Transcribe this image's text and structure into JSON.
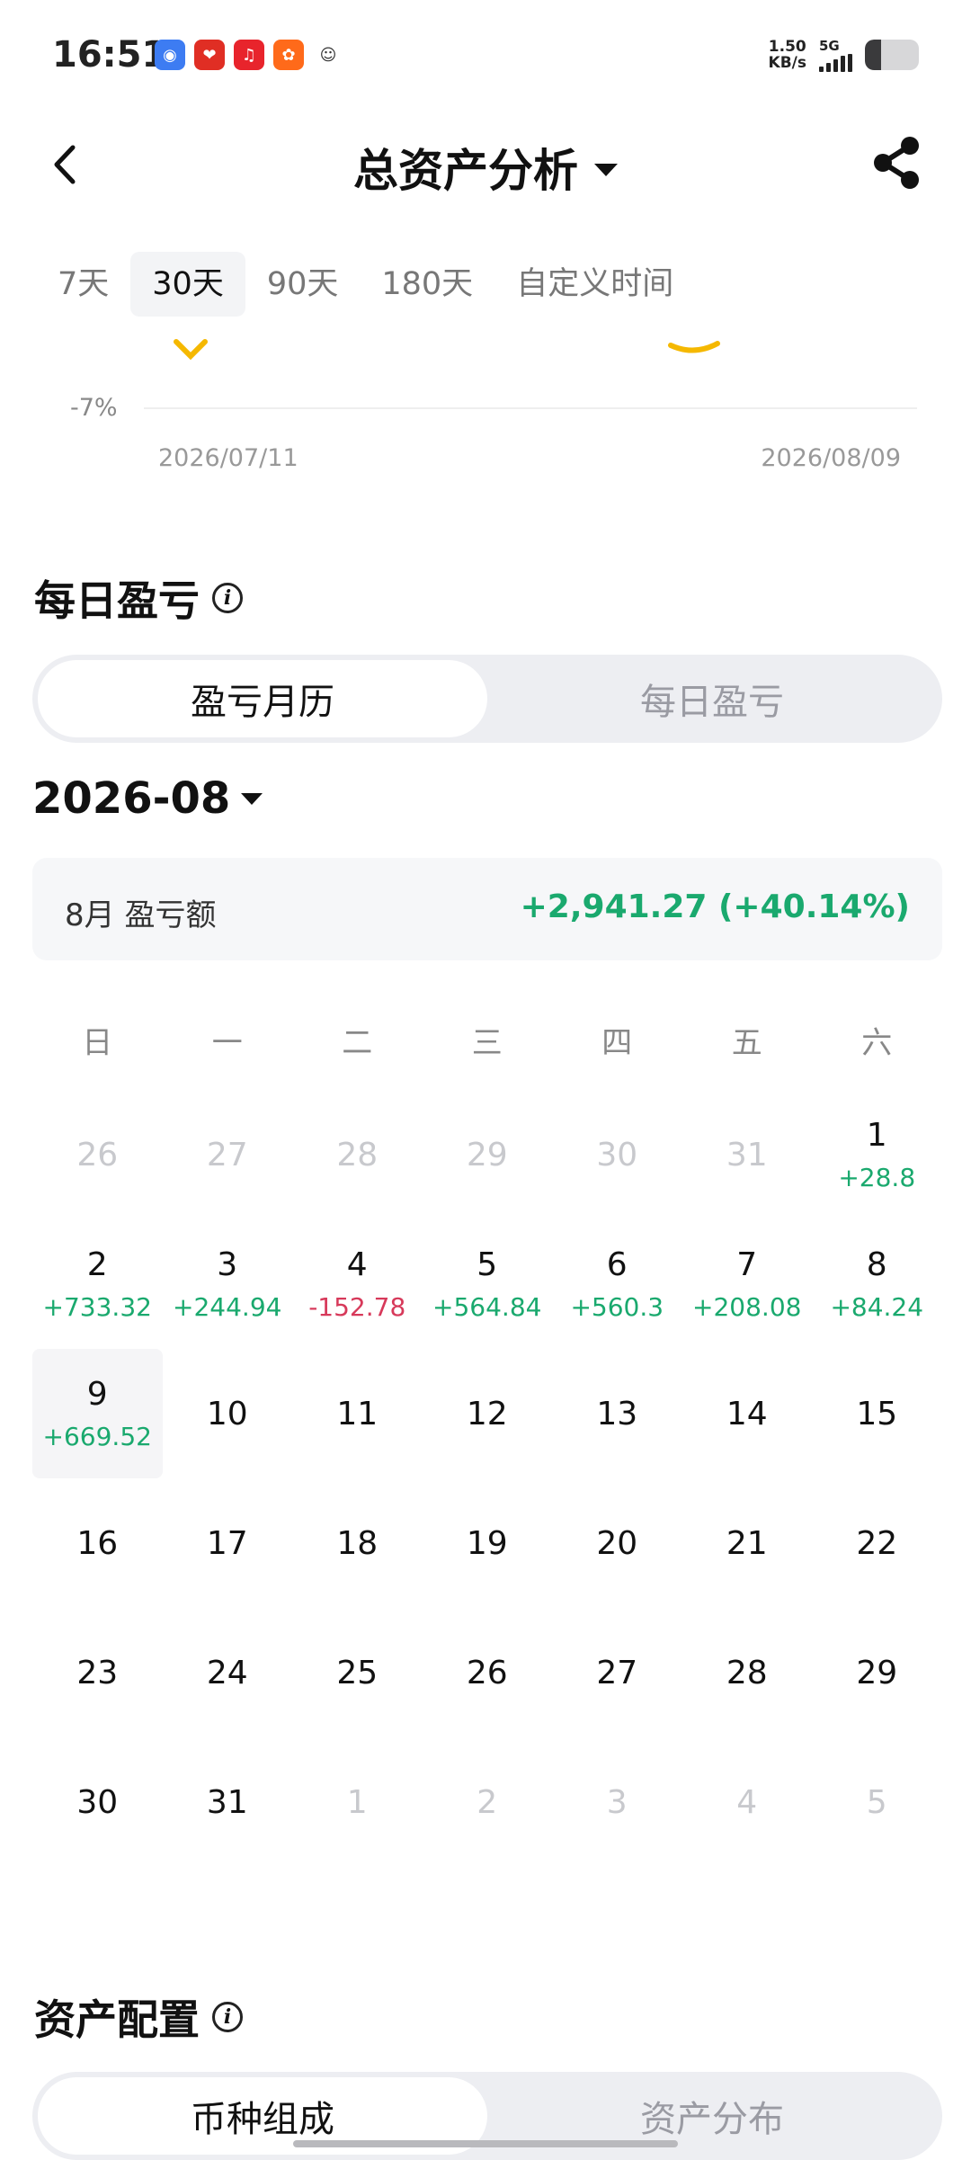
{
  "status": {
    "time": "16:51",
    "net_speed_value": "1.50",
    "net_speed_unit": "KB/s",
    "signal": "5G",
    "battery_level": 0.3,
    "apps": [
      {
        "icon": "baidu-icon",
        "color": "#3d7cf2",
        "glyph": "◉"
      },
      {
        "icon": "pinduoduo-icon",
        "color": "#e02e24",
        "glyph": "❤"
      },
      {
        "icon": "music-icon",
        "color": "#e8242c",
        "glyph": "♫"
      },
      {
        "icon": "kuaishou-icon",
        "color": "#ff6a1a",
        "glyph": "✿"
      },
      {
        "icon": "avatar-icon",
        "color": "#ffffff",
        "glyph": "☺"
      }
    ]
  },
  "header": {
    "title": "总资产分析"
  },
  "tabs": [
    "7天",
    "30天",
    "90天",
    "180天",
    "自定义时间"
  ],
  "active_tab": 1,
  "chart": {
    "y_label": "-7%",
    "x_start": "2026/07/11",
    "x_end": "2026/08/09"
  },
  "daily_pnl": {
    "title": "每日盈亏",
    "seg_active": "盈亏月历",
    "seg_inactive": "每日盈亏",
    "month": "2026-08",
    "summary_label": "8月 盈亏额",
    "summary_value": "+2,941.27 (+40.14%)",
    "weekdays": [
      "日",
      "一",
      "二",
      "三",
      "四",
      "五",
      "六"
    ],
    "days": [
      {
        "d": "26",
        "p": "",
        "t": "out"
      },
      {
        "d": "27",
        "p": "",
        "t": "out"
      },
      {
        "d": "28",
        "p": "",
        "t": "out"
      },
      {
        "d": "29",
        "p": "",
        "t": "out"
      },
      {
        "d": "30",
        "p": "",
        "t": "out"
      },
      {
        "d": "31",
        "p": "",
        "t": "out"
      },
      {
        "d": "1",
        "p": "+28.8",
        "t": "pos"
      },
      {
        "d": "2",
        "p": "+733.32",
        "t": "pos"
      },
      {
        "d": "3",
        "p": "+244.94",
        "t": "pos"
      },
      {
        "d": "4",
        "p": "-152.78",
        "t": "neg"
      },
      {
        "d": "5",
        "p": "+564.84",
        "t": "pos"
      },
      {
        "d": "6",
        "p": "+560.3",
        "t": "pos"
      },
      {
        "d": "7",
        "p": "+208.08",
        "t": "pos"
      },
      {
        "d": "8",
        "p": "+84.24",
        "t": "pos"
      },
      {
        "d": "9",
        "p": "+669.52",
        "t": "pos today"
      },
      {
        "d": "10",
        "p": "",
        "t": ""
      },
      {
        "d": "11",
        "p": "",
        "t": ""
      },
      {
        "d": "12",
        "p": "",
        "t": ""
      },
      {
        "d": "13",
        "p": "",
        "t": ""
      },
      {
        "d": "14",
        "p": "",
        "t": ""
      },
      {
        "d": "15",
        "p": "",
        "t": ""
      },
      {
        "d": "16",
        "p": "",
        "t": ""
      },
      {
        "d": "17",
        "p": "",
        "t": ""
      },
      {
        "d": "18",
        "p": "",
        "t": ""
      },
      {
        "d": "19",
        "p": "",
        "t": ""
      },
      {
        "d": "20",
        "p": "",
        "t": ""
      },
      {
        "d": "21",
        "p": "",
        "t": ""
      },
      {
        "d": "22",
        "p": "",
        "t": ""
      },
      {
        "d": "23",
        "p": "",
        "t": ""
      },
      {
        "d": "24",
        "p": "",
        "t": ""
      },
      {
        "d": "25",
        "p": "",
        "t": ""
      },
      {
        "d": "26",
        "p": "",
        "t": ""
      },
      {
        "d": "27",
        "p": "",
        "t": ""
      },
      {
        "d": "28",
        "p": "",
        "t": ""
      },
      {
        "d": "29",
        "p": "",
        "t": ""
      },
      {
        "d": "30",
        "p": "",
        "t": ""
      },
      {
        "d": "31",
        "p": "",
        "t": ""
      },
      {
        "d": "1",
        "p": "",
        "t": "out"
      },
      {
        "d": "2",
        "p": "",
        "t": "out"
      },
      {
        "d": "3",
        "p": "",
        "t": "out"
      },
      {
        "d": "4",
        "p": "",
        "t": "out"
      },
      {
        "d": "5",
        "p": "",
        "t": "out"
      }
    ]
  },
  "allocation": {
    "title": "资产配置",
    "seg_active": "币种组成",
    "seg_inactive": "资产分布"
  },
  "colors": {
    "positive": "#1aa96e",
    "negative": "#d7395a",
    "chart_accent": "#f5b800"
  }
}
